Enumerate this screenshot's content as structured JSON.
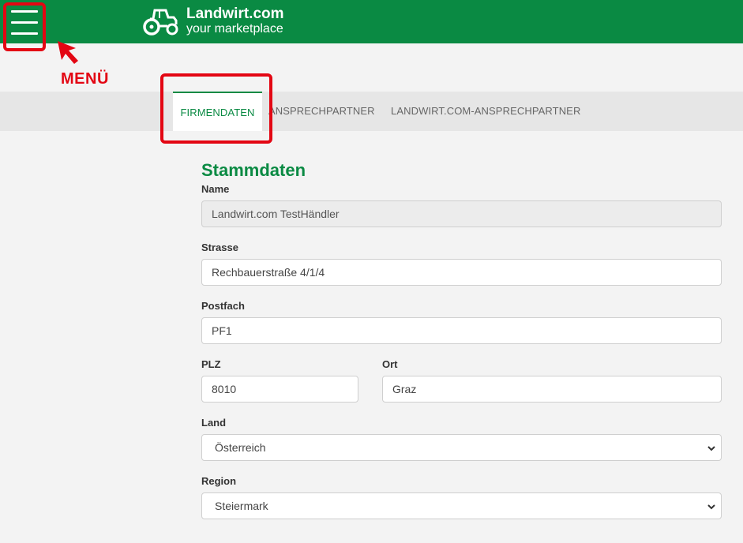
{
  "header": {
    "brand_name": "Landwirt.com",
    "brand_tagline": "your marketplace",
    "menu_icon": "hamburger-icon",
    "logo_icon": "tractor-icon",
    "colors": {
      "brand_green": "#0a8a43",
      "annotation_red": "#e30613"
    }
  },
  "annotation": {
    "menu_label": "MENÜ"
  },
  "tabs": [
    {
      "label": "FIRMENDATEN",
      "active": true
    },
    {
      "label": "ANSPRECHPARTNER",
      "active": false
    },
    {
      "label": "LANDWIRT.COM-ANSPRECHPARTNER",
      "active": false
    }
  ],
  "form": {
    "title": "Stammdaten",
    "name": {
      "label": "Name",
      "value": "Landwirt.com TestHändler"
    },
    "strasse": {
      "label": "Strasse",
      "value": "Rechbauerstraße 4/1/4"
    },
    "postfach": {
      "label": "Postfach",
      "value": "PF1"
    },
    "plz": {
      "label": "PLZ",
      "value": "8010"
    },
    "ort": {
      "label": "Ort",
      "value": "Graz"
    },
    "land": {
      "label": "Land",
      "value": "Österreich"
    },
    "region": {
      "label": "Region",
      "value": "Steiermark"
    }
  }
}
